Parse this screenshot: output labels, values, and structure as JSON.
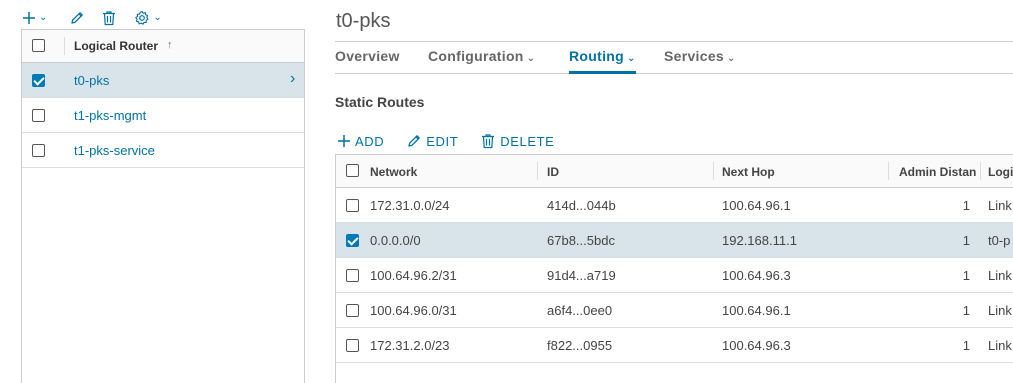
{
  "left_toolbar": {
    "add_icon": "plus-icon",
    "edit_icon": "pencil-icon",
    "delete_icon": "trash-icon",
    "settings_icon": "gear-icon",
    "caret": "⌄"
  },
  "left_panel": {
    "header": {
      "title": "Logical Router",
      "sort_indicator": "↑"
    },
    "routers": [
      {
        "name": "t0-pks",
        "checked": true,
        "selected": true
      },
      {
        "name": "t1-pks-mgmt",
        "checked": false,
        "selected": false
      },
      {
        "name": "t1-pks-service",
        "checked": false,
        "selected": false
      }
    ],
    "row_chevron": "›"
  },
  "detail": {
    "title": "t0-pks",
    "tabs": [
      {
        "label": "Overview",
        "active": false,
        "dropdown": false
      },
      {
        "label": "Configuration",
        "active": false,
        "dropdown": true
      },
      {
        "label": "Routing",
        "active": true,
        "dropdown": true
      },
      {
        "label": "Services",
        "active": false,
        "dropdown": true
      }
    ],
    "tab_caret": "⌄",
    "section_title": "Static Routes",
    "actions": {
      "add": "ADD",
      "edit": "EDIT",
      "delete": "DELETE"
    },
    "table": {
      "columns": {
        "network": "Network",
        "id": "ID",
        "next_hop": "Next Hop",
        "admin_distance": "Admin Distan",
        "logical": "Logi"
      },
      "rows": [
        {
          "network": "172.31.0.0/24",
          "id": "414d...044b",
          "next_hop": "100.64.96.1",
          "admin_distance": "1",
          "logical": "Link",
          "checked": false,
          "selected": false
        },
        {
          "network": "0.0.0.0/0",
          "id": "67b8...5bdc",
          "next_hop": "192.168.11.1",
          "admin_distance": "1",
          "logical": "t0-p",
          "checked": true,
          "selected": true
        },
        {
          "network": "100.64.96.2/31",
          "id": "91d4...a719",
          "next_hop": "100.64.96.3",
          "admin_distance": "1",
          "logical": "Link",
          "checked": false,
          "selected": false
        },
        {
          "network": "100.64.96.0/31",
          "id": "a6f4...0ee0",
          "next_hop": "100.64.96.1",
          "admin_distance": "1",
          "logical": "Link",
          "checked": false,
          "selected": false
        },
        {
          "network": "172.31.2.0/23",
          "id": "f822...0955",
          "next_hop": "100.64.96.3",
          "admin_distance": "1",
          "logical": "Link",
          "checked": false,
          "selected": false
        }
      ]
    }
  },
  "colors": {
    "accent": "#0072a3",
    "selected_row": "#d9e4ea",
    "checkbox_checked": "#0079b8"
  }
}
